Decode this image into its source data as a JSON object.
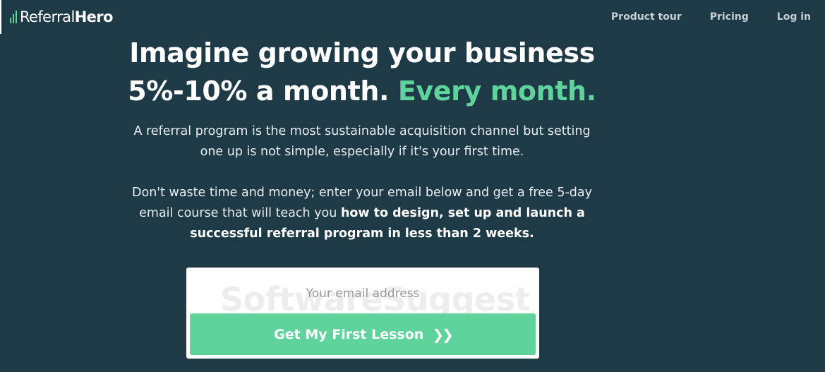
{
  "brand": {
    "name_regular": "Referral",
    "name_bold": "Hero",
    "accent": "#5ed39b",
    "background": "#1e3a47"
  },
  "nav": {
    "items": [
      "Product tour",
      "Pricing",
      "Log in"
    ]
  },
  "hero": {
    "headline_line1": "Imagine growing your business",
    "headline_line2_white": "5%-10% a month.",
    "headline_line2_accent": "Every month.",
    "paragraph1_line1": "A referral program is the most sustainable acquisition channel but setting",
    "paragraph1_line2": "one up is not simple, especially if it's your first time.",
    "paragraph2_line1": "Don't waste time and money; enter your email below and get a free 5-day",
    "paragraph2_line2_plain": "email course that will teach you",
    "paragraph2_line2_bold": "how to design, set up and launch a",
    "paragraph2_line3_bold": "successful referral program in less than 2 weeks."
  },
  "form": {
    "email_placeholder": "Your email address",
    "watermark": "SoftwareSuggest",
    "cta_label": "Get My First Lesson",
    "cta_icon": "double-chevron-right-icon"
  }
}
